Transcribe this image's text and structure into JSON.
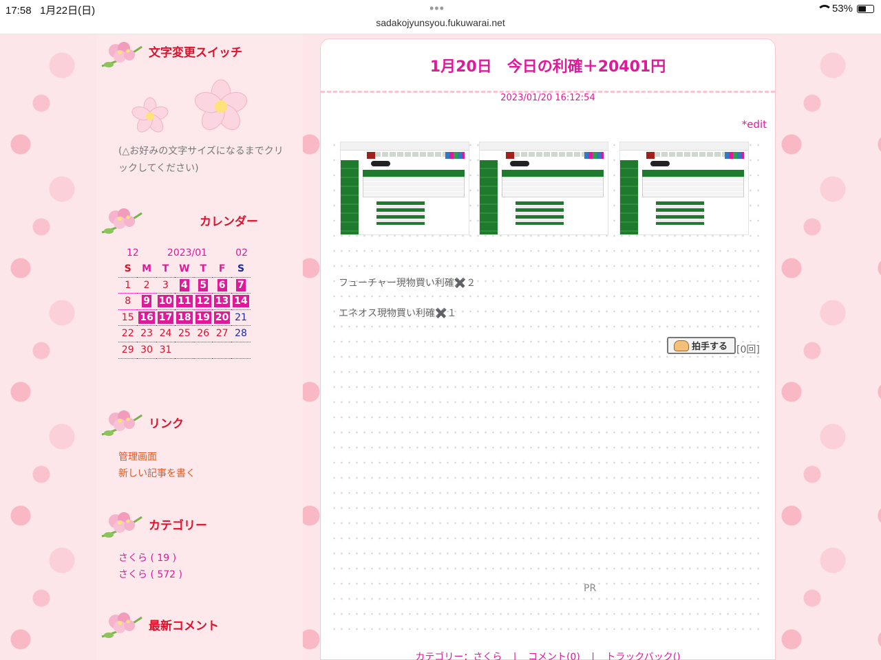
{
  "statusbar": {
    "time": "17:58",
    "date": "1月22日(日)",
    "url": "sadakojyunsyou.fukuwarai.net",
    "battery": "53%",
    "battery_level": 0.53
  },
  "sidebar": {
    "text_size_heading": "文字変更スイッチ",
    "text_size_note": "(△お好みの文字サイズになるまでクリックしてください)",
    "calendar_heading": "カレンダー",
    "calendar": {
      "prev": "12",
      "month": "2023/01",
      "next": "02",
      "weekdays": [
        "S",
        "M",
        "T",
        "W",
        "T",
        "F",
        "S"
      ],
      "rows": [
        [
          "1",
          "2",
          "3",
          "4",
          "5",
          "6",
          "7"
        ],
        [
          "8",
          "9",
          "10",
          "11",
          "12",
          "13",
          "14"
        ],
        [
          "15",
          "16",
          "17",
          "18",
          "19",
          "20",
          "21"
        ],
        [
          "22",
          "23",
          "24",
          "25",
          "26",
          "27",
          "28"
        ],
        [
          "29",
          "30",
          "31",
          "",
          "",
          "",
          ""
        ]
      ],
      "marked_days": [
        "4",
        "5",
        "6",
        "7",
        "9",
        "10",
        "11",
        "12",
        "13",
        "14",
        "16",
        "17",
        "18",
        "19",
        "20"
      ]
    },
    "links_heading": "リンク",
    "links": [
      "管理画面",
      "新しい記事を書く"
    ],
    "category_heading": "カテゴリー",
    "categories": [
      "さくら ( 19 )",
      "さくら ( 572 )"
    ],
    "comments_heading": "最新コメント"
  },
  "post": {
    "title": "1月20日　今日の利確＋20401円",
    "date": "2023/01/20 16:12:54",
    "edit": "*edit",
    "lines": [
      "フューチャー現物買い利確✖️２",
      "エネオス現物買い利確✖️１"
    ],
    "clap_label": "拍手する",
    "clap_count": "[0回]",
    "pr": "PR",
    "footer": {
      "category": "カテゴリー：さくら",
      "sep": "|",
      "comments": "コメント(0)",
      "trackback": "トラックバック()"
    }
  },
  "colors": {
    "accent": "#e0199a",
    "heading_red": "#e0102a",
    "link_orange": "#e05a20"
  }
}
